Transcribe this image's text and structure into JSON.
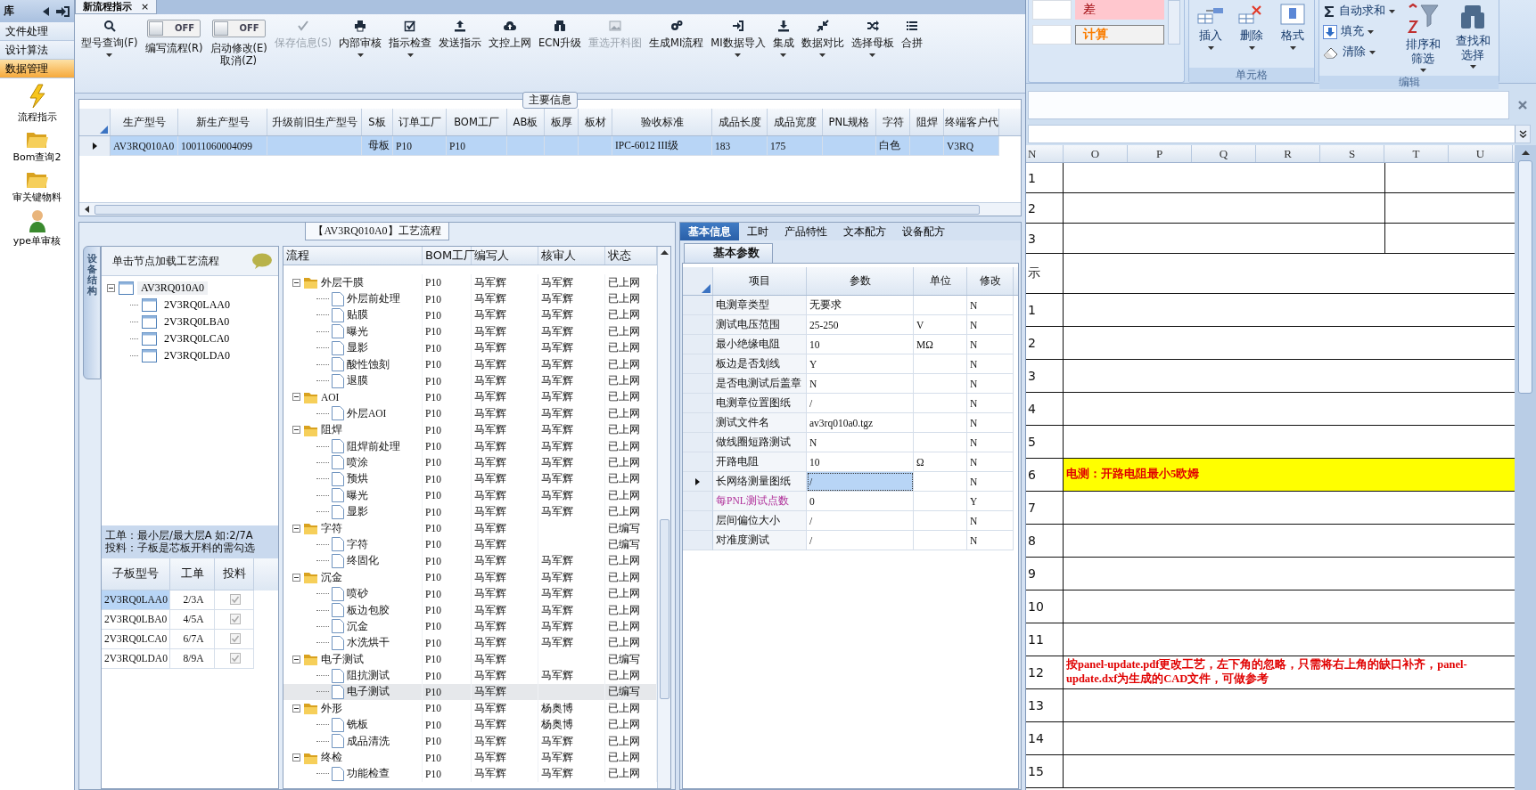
{
  "sidebar": {
    "header": "库",
    "items": [
      {
        "label": "文件处理",
        "selected": false
      },
      {
        "label": "设计算法",
        "selected": false
      },
      {
        "label": "数据管理",
        "selected": true
      }
    ],
    "launchers": [
      {
        "label": "流程指示"
      },
      {
        "label": "Bom查询2"
      },
      {
        "label": "审关键物料"
      },
      {
        "label": "ype单审核"
      }
    ]
  },
  "document_tabs": [
    {
      "label": "新流程指示",
      "selected": true,
      "close": "×"
    }
  ],
  "toolbar": [
    {
      "label": "型号查询(F)",
      "kind": "dropdown",
      "disabled": false
    },
    {
      "label": "编写流程(R)",
      "kind": "toggle",
      "switch": {
        "text": "OFF",
        "on": false
      }
    },
    {
      "label": "启动修改(E)",
      "sublabel": "取消(Z)",
      "kind": "toggle",
      "switch": {
        "text": "OFF",
        "on": false
      }
    },
    {
      "label": "保存信息(S)",
      "kind": "plain",
      "disabled": true
    },
    {
      "label": "内部审核",
      "kind": "dropdown",
      "disabled": false
    },
    {
      "label": "指示检查",
      "kind": "dropdown",
      "disabled": false
    },
    {
      "label": "发送指示",
      "kind": "plain",
      "disabled": false
    },
    {
      "label": "文控上网",
      "kind": "plain",
      "disabled": false
    },
    {
      "label": "ECN升级",
      "kind": "plain",
      "disabled": false
    },
    {
      "label": "重选开料图",
      "kind": "plain",
      "disabled": true
    },
    {
      "label": "生成MI流程",
      "kind": "plain",
      "disabled": false
    },
    {
      "label": "MI数据导入",
      "kind": "dropdown",
      "disabled": false
    },
    {
      "label": "集成",
      "kind": "dropdown",
      "disabled": false
    },
    {
      "label": "数据对比",
      "kind": "dropdown",
      "disabled": false
    },
    {
      "label": "选择母板",
      "kind": "dropdown",
      "disabled": false
    },
    {
      "label": "合拼",
      "kind": "plain",
      "disabled": false
    }
  ],
  "main_info": {
    "title": "主要信息",
    "columns": [
      "生产型号",
      "新生产型号",
      "升级前旧生产型号",
      "S板",
      "订单工厂",
      "BOM工厂",
      "AB板",
      "板厚",
      "板材",
      "验收标准",
      "成品长度",
      "成品宽度",
      "PNL规格",
      "字符",
      "阻焊",
      "终端客户代"
    ],
    "rows": [
      {
        "selected": true,
        "cells": [
          "AV3RQ010A0",
          "10011060004099",
          null,
          "母板",
          "P10",
          "P10",
          null,
          null,
          null,
          "IPC-6012 III级",
          "183",
          "175",
          null,
          "白色",
          null,
          "V3RQ"
        ]
      }
    ]
  },
  "process": {
    "title": "【AV3RQ010A0】工艺流程",
    "side_tab": "设备结构",
    "hint": "单击节点加载工艺流程",
    "tree": {
      "label": "AV3RQ010A0",
      "expanded": true,
      "selected": true,
      "children": [
        {
          "label": "2V3RQ0LAA0",
          "selected": false
        },
        {
          "label": "2V3RQ0LBA0",
          "selected": false
        },
        {
          "label": "2V3RQ0LCA0",
          "selected": false
        },
        {
          "label": "2V3RQ0LDA0",
          "selected": false
        }
      ]
    },
    "notes": [
      "工单：最小层/最大层A 如:2/7A",
      "投料：子板是芯板开料的需勾选"
    ],
    "sub_boards": {
      "columns": [
        "子板型号",
        "工单",
        "投料"
      ],
      "rows": [
        {
          "model": "2V3RQ0LAA0",
          "order": "2/3A",
          "checked": true,
          "selected": true
        },
        {
          "model": "2V3RQ0LBA0",
          "order": "4/5A",
          "checked": true,
          "selected": false
        },
        {
          "model": "2V3RQ0LCA0",
          "order": "6/7A",
          "checked": true,
          "selected": false
        },
        {
          "model": "2V3RQ0LDA0",
          "order": "8/9A",
          "checked": true,
          "selected": false
        }
      ]
    },
    "flow": {
      "columns": [
        "流程",
        "BOM工厂",
        "编写人",
        "核审人",
        "状态"
      ],
      "rows": [
        {
          "label": "外层干膜",
          "bom": "P10",
          "writer": "马军辉",
          "reviewer": "马军辉",
          "status": "已上网",
          "expanded": true,
          "selected": false,
          "children": [
            {
              "label": "外层前处理",
              "bom": "P10",
              "writer": "马军辉",
              "reviewer": "马军辉",
              "status": "已上网",
              "selected": false
            },
            {
              "label": "贴膜",
              "bom": "P10",
              "writer": "马军辉",
              "reviewer": "马军辉",
              "status": "已上网",
              "selected": false
            },
            {
              "label": "曝光",
              "bom": "P10",
              "writer": "马军辉",
              "reviewer": "马军辉",
              "status": "已上网",
              "selected": false
            },
            {
              "label": "显影",
              "bom": "P10",
              "writer": "马军辉",
              "reviewer": "马军辉",
              "status": "已上网",
              "selected": false
            },
            {
              "label": "酸性蚀刻",
              "bom": "P10",
              "writer": "马军辉",
              "reviewer": "马军辉",
              "status": "已上网",
              "selected": false
            },
            {
              "label": "退膜",
              "bom": "P10",
              "writer": "马军辉",
              "reviewer": "马军辉",
              "status": "已上网",
              "selected": false
            }
          ]
        },
        {
          "label": "AOI",
          "bom": "P10",
          "writer": "马军辉",
          "reviewer": "马军辉",
          "status": "已上网",
          "expanded": true,
          "selected": false,
          "children": [
            {
              "label": "外层AOI",
              "bom": "P10",
              "writer": "马军辉",
              "reviewer": "马军辉",
              "status": "已上网",
              "selected": false
            }
          ]
        },
        {
          "label": "阻焊",
          "bom": "P10",
          "writer": "马军辉",
          "reviewer": "马军辉",
          "status": "已上网",
          "expanded": true,
          "selected": false,
          "children": [
            {
              "label": "阻焊前处理",
              "bom": "P10",
              "writer": "马军辉",
              "reviewer": "马军辉",
              "status": "已上网",
              "selected": false
            },
            {
              "label": "喷涂",
              "bom": "P10",
              "writer": "马军辉",
              "reviewer": "马军辉",
              "status": "已上网",
              "selected": false
            },
            {
              "label": "预烘",
              "bom": "P10",
              "writer": "马军辉",
              "reviewer": "马军辉",
              "status": "已上网",
              "selected": false
            },
            {
              "label": "曝光",
              "bom": "P10",
              "writer": "马军辉",
              "reviewer": "马军辉",
              "status": "已上网",
              "selected": false
            },
            {
              "label": "显影",
              "bom": "P10",
              "writer": "马军辉",
              "reviewer": "马军辉",
              "status": "已上网",
              "selected": false
            }
          ]
        },
        {
          "label": "字符",
          "bom": "P10",
          "writer": "马军辉",
          "status": "已编写",
          "expanded": true,
          "selected": false,
          "children": [
            {
              "label": "字符",
              "bom": "P10",
              "writer": "马军辉",
              "status": "已编写",
              "selected": false
            },
            {
              "label": "终固化",
              "bom": "P10",
              "writer": "马军辉",
              "reviewer": "马军辉",
              "status": "已上网",
              "selected": false
            }
          ]
        },
        {
          "label": "沉金",
          "bom": "P10",
          "writer": "马军辉",
          "reviewer": "马军辉",
          "status": "已上网",
          "expanded": true,
          "selected": false,
          "children": [
            {
              "label": "喷砂",
              "bom": "P10",
              "writer": "马军辉",
              "reviewer": "马军辉",
              "status": "已上网",
              "selected": false
            },
            {
              "label": "板边包胶",
              "bom": "P10",
              "writer": "马军辉",
              "reviewer": "马军辉",
              "status": "已上网",
              "selected": false
            },
            {
              "label": "沉金",
              "bom": "P10",
              "writer": "马军辉",
              "reviewer": "马军辉",
              "status": "已上网",
              "selected": false
            },
            {
              "label": "水洗烘干",
              "bom": "P10",
              "writer": "马军辉",
              "reviewer": "马军辉",
              "status": "已上网",
              "selected": false
            }
          ]
        },
        {
          "label": "电子测试",
          "bom": "P10",
          "writer": "马军辉",
          "status": "已编写",
          "expanded": true,
          "selected": false,
          "children": [
            {
              "label": "阻抗测试",
              "bom": "P10",
              "writer": "马军辉",
              "reviewer": "马军辉",
              "status": "已上网",
              "selected": false
            },
            {
              "label": "电子测试",
              "bom": "P10",
              "writer": "马军辉",
              "status": "已编写",
              "selected": true
            }
          ]
        },
        {
          "label": "外形",
          "bom": "P10",
          "writer": "马军辉",
          "reviewer": "杨奥博",
          "status": "已上网",
          "expanded": true,
          "selected": false,
          "children": [
            {
              "label": "铣板",
              "bom": "P10",
              "writer": "马军辉",
              "reviewer": "杨奥博",
              "status": "已上网",
              "selected": false
            },
            {
              "label": "成品清洗",
              "bom": "P10",
              "writer": "马军辉",
              "reviewer": "马军辉",
              "status": "已上网",
              "selected": false
            }
          ]
        },
        {
          "label": "终检",
          "bom": "P10",
          "writer": "马军辉",
          "reviewer": "马军辉",
          "status": "已上网",
          "expanded": true,
          "selected": false,
          "children": [
            {
              "label": "功能检查",
              "bom": "P10",
              "writer": "马军辉",
              "reviewer": "马军辉",
              "status": "已上网",
              "selected": false
            }
          ]
        }
      ]
    }
  },
  "basic_info": {
    "tabs": [
      {
        "label": "基本信息",
        "selected": true
      },
      {
        "label": "工时",
        "selected": false
      },
      {
        "label": "产品特性",
        "selected": false
      },
      {
        "label": "文本配方",
        "selected": false
      },
      {
        "label": "设备配方",
        "selected": false
      }
    ],
    "sub_tab": "基本参数",
    "columns": [
      "项目",
      "参数",
      "单位",
      "修改"
    ],
    "rows": [
      {
        "item": "电测章类型",
        "value": "无要求",
        "modified": "N",
        "selected": false,
        "emphasized": false
      },
      {
        "item": "测试电压范围",
        "value": "25-250",
        "unit": "V",
        "modified": "N",
        "selected": false,
        "emphasized": false
      },
      {
        "item": "最小绝缘电阻",
        "value": "10",
        "unit": "MΩ",
        "modified": "N",
        "selected": false,
        "emphasized": false
      },
      {
        "item": "板边是否划线",
        "value": "Y",
        "modified": "N",
        "selected": false,
        "emphasized": false
      },
      {
        "item": "是否电测试后盖章",
        "value": "N",
        "modified": "N",
        "selected": false,
        "emphasized": false
      },
      {
        "item": "电测章位置图纸",
        "value": "/",
        "modified": "N",
        "selected": false,
        "emphasized": false
      },
      {
        "item": "测试文件名",
        "value": "av3rq010a0.tgz",
        "modified": "N",
        "selected": false,
        "emphasized": false
      },
      {
        "item": "做线圈短路测试",
        "value": "N",
        "modified": "N",
        "selected": false,
        "emphasized": false
      },
      {
        "item": "开路电阻",
        "value": "10",
        "unit": "Ω",
        "modified": "N",
        "selected": false,
        "emphasized": false
      },
      {
        "item": "长网络测量图纸",
        "value": "/",
        "modified": "N",
        "selected": true,
        "emphasized": false
      },
      {
        "item": "每PNL测试点数",
        "value": "0",
        "modified": "Y",
        "selected": false,
        "emphasized": true
      },
      {
        "item": "层间偏位大小",
        "value": "/",
        "modified": "N",
        "selected": false,
        "emphasized": false
      },
      {
        "item": "对准度测试",
        "value": "/",
        "modified": "N",
        "selected": false,
        "emphasized": false
      }
    ]
  },
  "excel": {
    "style_gallery": [
      {
        "label": "差",
        "kind": "bad"
      },
      {
        "label": "计算",
        "kind": "calc"
      }
    ],
    "cells_group": {
      "title": "单元格",
      "buttons": [
        {
          "label": "插入"
        },
        {
          "label": "删除"
        },
        {
          "label": "格式"
        }
      ]
    },
    "editing_group": {
      "title": "编辑",
      "small_buttons": [
        {
          "label": "自动求和"
        },
        {
          "label": "填充"
        },
        {
          "label": "清除"
        }
      ],
      "large_buttons": [
        {
          "lines": [
            "排序和",
            "筛选"
          ]
        },
        {
          "lines": [
            "查找和",
            "选择"
          ]
        }
      ]
    },
    "sheet": {
      "columns": [
        "N",
        "O",
        "P",
        "Q",
        "R",
        "S",
        "T",
        "U"
      ],
      "rows": [
        {
          "label": "1",
          "kind": "split",
          "highlighted": false
        },
        {
          "label": "2",
          "kind": "split",
          "highlighted": false
        },
        {
          "label": "3",
          "kind": "split",
          "highlighted": false
        },
        {
          "label": "示",
          "kind": "tall",
          "highlighted": false
        },
        {
          "label": "1",
          "kind": "normal",
          "highlighted": false
        },
        {
          "label": "2",
          "kind": "normal",
          "highlighted": false
        },
        {
          "label": "3",
          "kind": "normal",
          "highlighted": false
        },
        {
          "label": "4",
          "kind": "normal",
          "highlighted": false
        },
        {
          "label": "5",
          "kind": "normal",
          "highlighted": false
        },
        {
          "label": "6",
          "kind": "normal",
          "highlighted": true,
          "note": "电测：开路电阻最小5欧姆"
        },
        {
          "label": "7",
          "kind": "normal",
          "highlighted": false
        },
        {
          "label": "8",
          "kind": "normal",
          "highlighted": false
        },
        {
          "label": "9",
          "kind": "normal",
          "highlighted": false
        },
        {
          "label": "10",
          "kind": "normal",
          "highlighted": false
        },
        {
          "label": "11",
          "kind": "normal",
          "highlighted": false
        },
        {
          "label": "12",
          "kind": "normal",
          "highlighted": false,
          "note": "按panel-update.pdf更改工艺，左下角的忽略，只需将右上角的缺口补齐，panel-update.dxf为生成的CAD文件，可做参考"
        },
        {
          "label": "13",
          "kind": "normal",
          "highlighted": false
        },
        {
          "label": "14",
          "kind": "normal",
          "highlighted": false
        },
        {
          "label": "15",
          "kind": "normal",
          "highlighted": false
        }
      ]
    }
  }
}
